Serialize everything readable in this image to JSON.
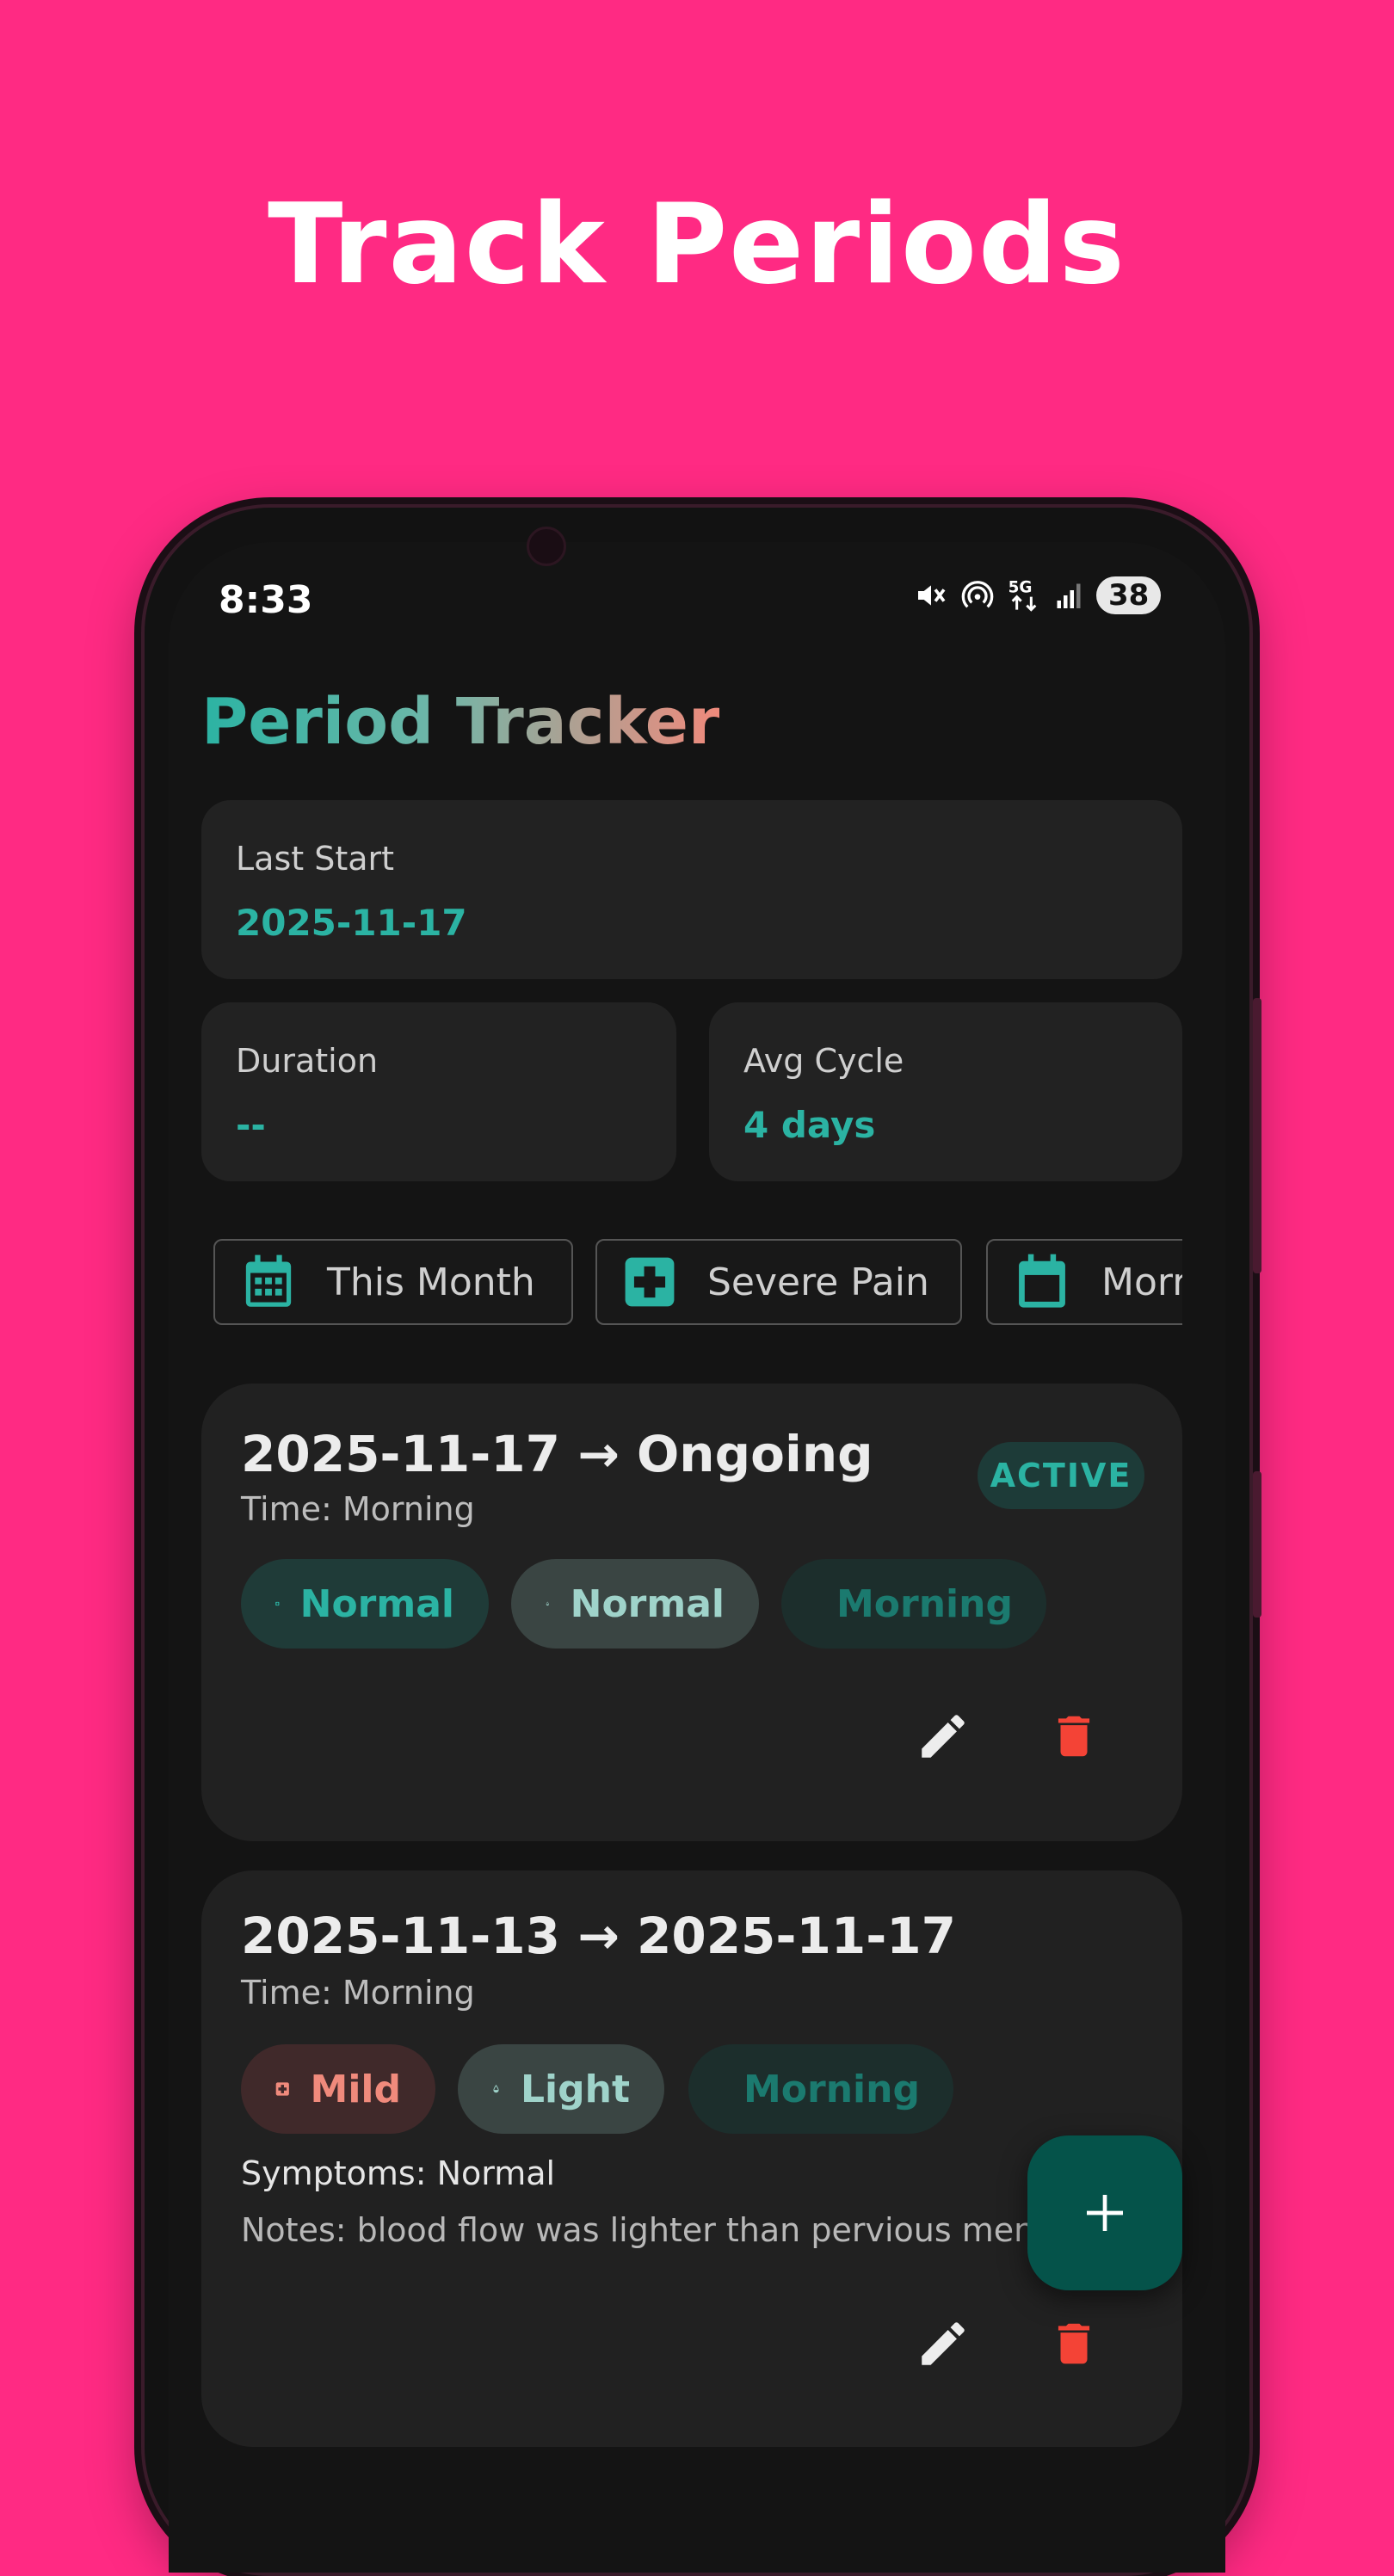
{
  "headline": "Track Periods",
  "status": {
    "time": "8:33",
    "battery": "38"
  },
  "app": {
    "title": "Period Tracker"
  },
  "stats": {
    "last_start": {
      "label": "Last Start",
      "value": "2025-11-17"
    },
    "duration": {
      "label": "Duration",
      "value": "--"
    },
    "avg_cycle": {
      "label": "Avg Cycle",
      "value": "4 days"
    }
  },
  "filters": [
    {
      "label": "This Month",
      "icon": "calendar-grid-icon"
    },
    {
      "label": "Severe Pain",
      "icon": "medical-cross-icon"
    },
    {
      "label": "Morr",
      "icon": "calendar-icon"
    }
  ],
  "periods": [
    {
      "range": "2025-11-17 → Ongoing",
      "time": "Time: Morning",
      "badge": "ACTIVE",
      "pain": "Normal",
      "flow": "Normal",
      "tod": "Morning"
    },
    {
      "range": "2025-11-13 → 2025-11-17",
      "time": "Time: Morning",
      "pain": "Mild",
      "flow": "Light",
      "tod": "Morning",
      "symptoms": "Symptoms: Normal",
      "notes": "Notes: blood flow was lighter than pervious  menstrua"
    }
  ],
  "colors": {
    "background": "#ff2a83",
    "accent": "#2bb3a3",
    "delete": "#f44336",
    "fab": "#05534a",
    "card": "#222222"
  }
}
